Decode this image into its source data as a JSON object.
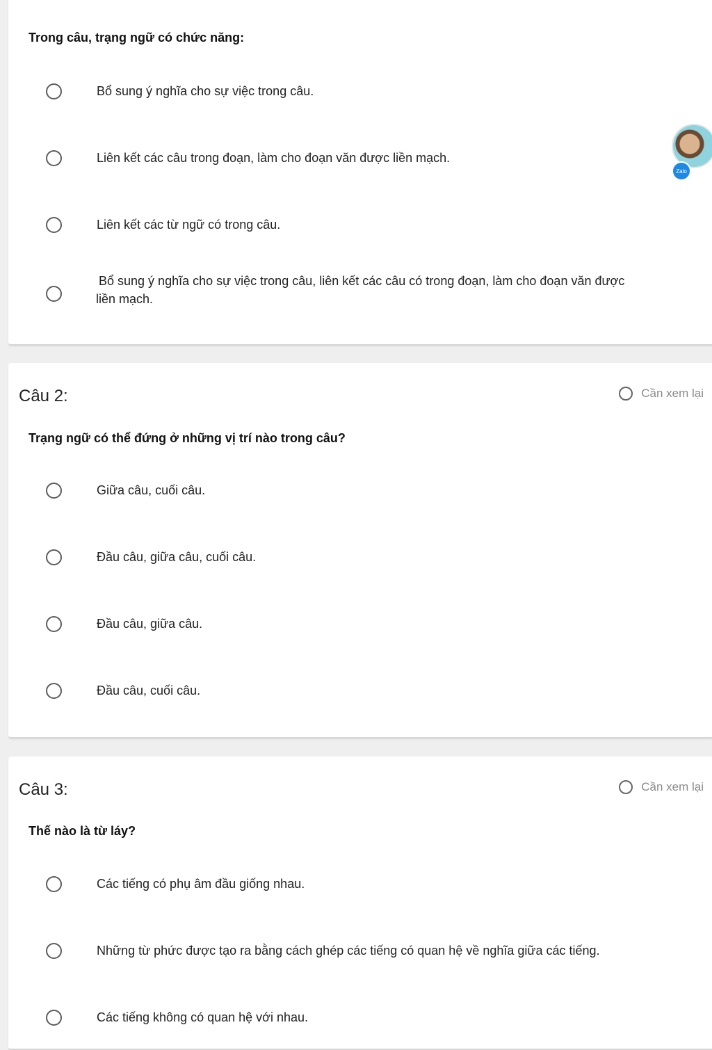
{
  "review_label": "Cần xem lại",
  "questions": [
    {
      "text": "Trong câu, trạng ngữ có chức năng:",
      "options": [
        "Bổ sung ý nghĩa cho sự việc trong câu.",
        "Liên kết các câu trong đoạn, làm cho đoạn văn được liền mạch.",
        "Liên kết các từ ngữ có trong câu.",
        "Bổ sung ý nghĩa cho sự việc trong câu, liên kết các câu có trong đoạn, làm cho đoạn văn được",
        "liền mạch."
      ]
    },
    {
      "title": "Câu 2:",
      "text": "Trạng ngữ có thể đứng ở những vị trí nào trong câu?",
      "options": [
        "Giữa câu, cuối câu.",
        "Đầu câu, giữa câu, cuối câu.",
        "Đầu câu, giữa câu.",
        "Đầu câu, cuối câu."
      ]
    },
    {
      "title": "Câu 3:",
      "text": "Thế nào là từ láy?",
      "options": [
        "Các tiếng có phụ âm đầu giống nhau.",
        "Những từ phức được tạo ra bằng cách ghép các tiếng có quan hệ về nghĩa giữa các tiếng.",
        "Các tiếng không có quan hệ với nhau."
      ]
    }
  ],
  "chathead": {
    "badge": "Zalo",
    "icon": "zalo-chat-bubble"
  }
}
